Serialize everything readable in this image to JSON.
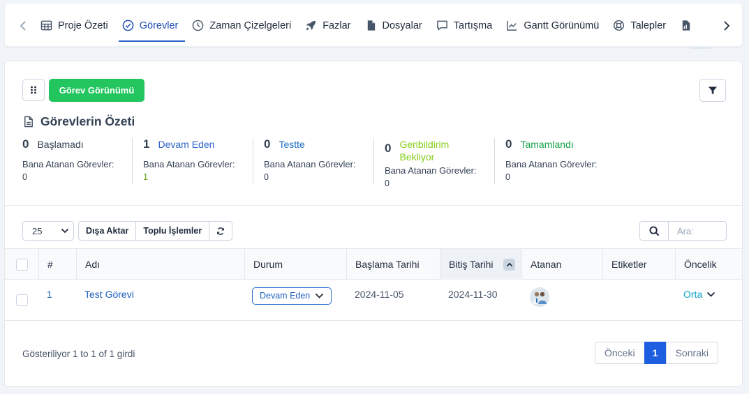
{
  "tabs": [
    {
      "label": "Proje Özeti",
      "icon": "table-icon",
      "active": false
    },
    {
      "label": "Görevler",
      "icon": "check-circle-icon",
      "active": true
    },
    {
      "label": "Zaman Çizelgeleri",
      "icon": "clock-icon",
      "active": false
    },
    {
      "label": "Fazlar",
      "icon": "rocket-icon",
      "active": false
    },
    {
      "label": "Dosyalar",
      "icon": "file-icon",
      "active": false
    },
    {
      "label": "Tartışma",
      "icon": "comment-icon",
      "active": false
    },
    {
      "label": "Gantt Görünümü",
      "icon": "chart-icon",
      "active": false
    },
    {
      "label": "Talepler",
      "icon": "lifebuoy-icon",
      "active": false
    },
    {
      "label": "",
      "icon": "document-chart-icon",
      "active": false
    }
  ],
  "toolbar": {
    "view_button": "Görev Görünümü"
  },
  "summary": {
    "title": "Görevlerin Özeti",
    "stats": [
      {
        "count": "0",
        "label": "Başlamadı",
        "color": "#334155",
        "assigned_label": "Bana Atanan Görevler:",
        "assigned_value": "0",
        "value_color": "#334155"
      },
      {
        "count": "1",
        "label": "Devam Eden",
        "color": "#2b63c9",
        "assigned_label": "Bana Atanan Görevler:",
        "assigned_value": "1",
        "value_color": "#65a30d"
      },
      {
        "count": "0",
        "label": "Testte",
        "color": "#1d6fc2",
        "assigned_label": "Bana Atanan Görevler:",
        "assigned_value": "0",
        "value_color": "#334155"
      },
      {
        "count": "0",
        "label": "Geribildirim Bekliyor",
        "color": "#84cc16",
        "assigned_label": "Bana Atanan Görevler:",
        "assigned_value": "0",
        "value_color": "#334155"
      },
      {
        "count": "0",
        "label": "Tamamlandı",
        "color": "#16a34a",
        "assigned_label": "Bana Atanan Görevler:",
        "assigned_value": "0",
        "value_color": "#334155"
      }
    ]
  },
  "table_tools": {
    "page_size": "25",
    "export_label": "Dışa Aktar",
    "bulk_label": "Toplu İşlemler",
    "search_placeholder": "Ara:"
  },
  "table": {
    "columns": [
      "#",
      "Adı",
      "Durum",
      "Başlama Tarihi",
      "Bitiş Tarihi",
      "Atanan",
      "Etiketler",
      "Öncelik"
    ],
    "rows": [
      {
        "id": "1",
        "name": "Test Görevi",
        "status": "Devam Eden",
        "start": "2024-11-05",
        "end": "2024-11-30",
        "tags": "",
        "priority": "Orta"
      }
    ]
  },
  "footer": {
    "info": "Gösteriliyor 1 to 1 of 1 girdi",
    "prev": "Önceki",
    "page": "1",
    "next": "Sonraki"
  },
  "colors": {
    "accent": "#2b63c9",
    "green_button": "#22c55e",
    "pager_active": "#1d5fe0"
  }
}
